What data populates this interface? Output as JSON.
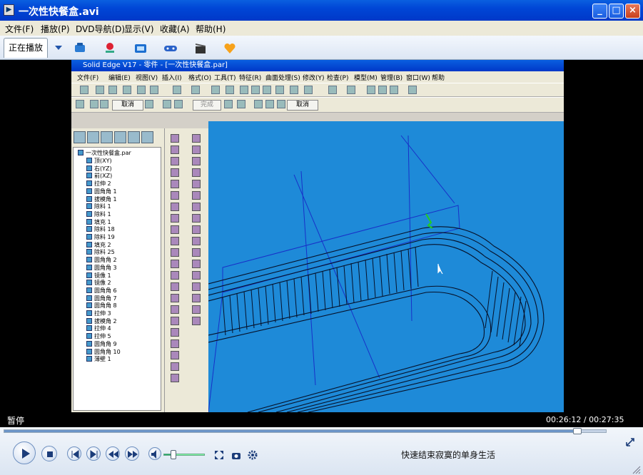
{
  "window": {
    "title": "一次性快餐盒.avi",
    "minimize": "_",
    "maximize": "□",
    "close": "×"
  },
  "menu": [
    "文件(F)",
    "播放(P)",
    "DVD导航(D)",
    "显示(V)",
    "收藏(A)",
    "帮助(H)"
  ],
  "toolbar": {
    "tab_now_playing": "正在播放",
    "icons": [
      "chevron-down-icon",
      "phone-icon",
      "map-pin-icon",
      "tv-icon",
      "gamepad-icon",
      "clapperboard-icon",
      "heart-icon"
    ]
  },
  "video": {
    "app": {
      "title": "Solid Edge V17 - 零件 - [一次性快餐盒.par]",
      "menu": [
        "文件(F)",
        "编辑(E)",
        "视图(V)",
        "插入(I)",
        "格式(O)",
        "工具(T)",
        "特征(R)",
        "曲面处理(S)",
        "修改(Y)",
        "检查(P)",
        "模型(M)",
        "管理(B)",
        "窗口(W)",
        "帮助"
      ],
      "cancel_label": "取消",
      "finish_label": "完成",
      "tree_root": "一次性快餐盒.par",
      "tree_items": [
        "顶(XY)",
        "右(YZ)",
        "前(XZ)",
        "拉伸 2",
        "圆角角 1",
        "拔模角 1",
        "除料 1",
        "除料 1",
        "填充 1",
        "除料 18",
        "除料 19",
        "填充 2",
        "除料 25",
        "圆角角 2",
        "圆角角 3",
        "镜像 1",
        "镜像 2",
        "圆角角 6",
        "圆角角 7",
        "圆角角 8",
        "拉伸 3",
        "拔模角 2",
        "拉伸 4",
        "拉伸 5",
        "圆角角 9",
        "圆角角 10",
        "薄壁 1"
      ]
    }
  },
  "status": {
    "state": "暂停",
    "time": "00:26:12 / 00:27:35"
  },
  "controls": {
    "now_playing": "快速结束寂寞的单身生活",
    "seek_fraction": 0.95,
    "volume_fraction": 0.22
  }
}
